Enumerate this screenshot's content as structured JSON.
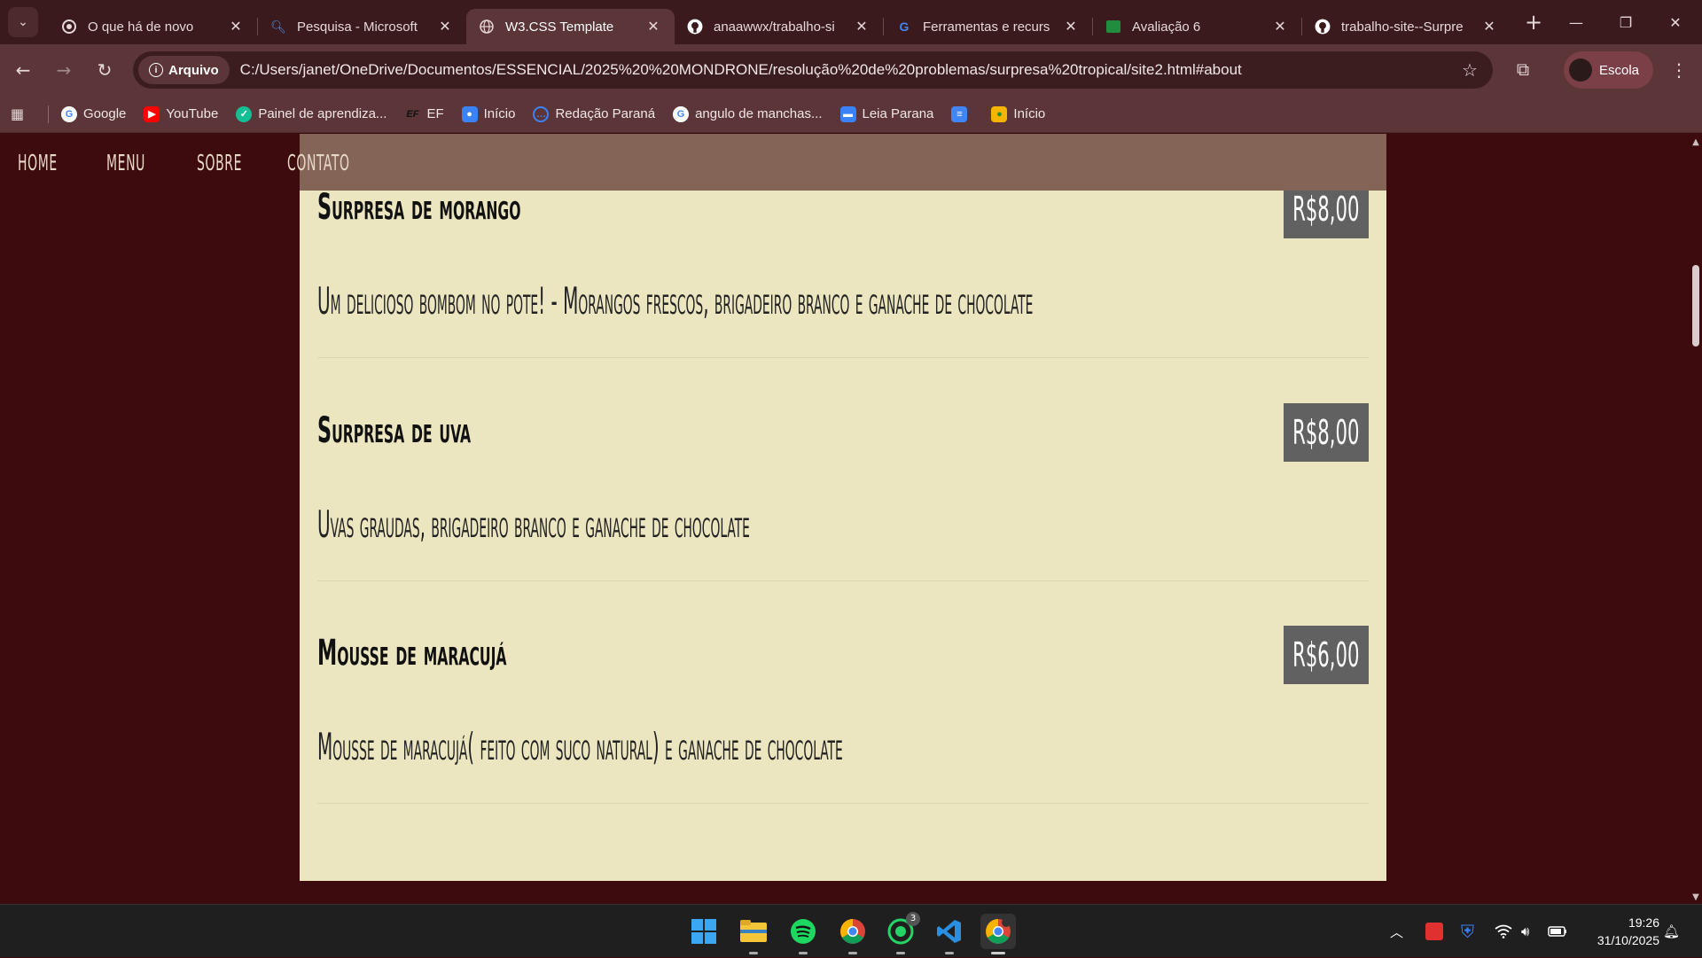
{
  "browser": {
    "tabs": [
      {
        "title": "O que há de novo",
        "icon": "chrome-icon",
        "active": false
      },
      {
        "title": "Pesquisa - Microsoft",
        "icon": "search-icon",
        "active": false
      },
      {
        "title": "W3.CSS Template",
        "icon": "globe-icon",
        "active": true
      },
      {
        "title": "anaawwx/trabalho-si",
        "icon": "github-icon",
        "active": false
      },
      {
        "title": "Ferramentas e recurs",
        "icon": "google-icon",
        "active": false
      },
      {
        "title": "Avaliação 6",
        "icon": "classroom-icon",
        "active": false
      },
      {
        "title": "trabalho-site--Surpre",
        "icon": "github-icon",
        "active": false
      }
    ],
    "security_chip": "Arquivo",
    "url": "C:/Users/janet/OneDrive/Documentos/ESSENCIAL/2025%20%20MONDRONE/resolução%20de%20problemas/surpresa%20tropical/site2.html#about",
    "profile_name": "Escola",
    "bookmarks": [
      {
        "label": "Google",
        "icon": "google-icon",
        "color": "#ffffff"
      },
      {
        "label": "YouTube",
        "icon": "youtube-icon",
        "color": "#ff0000"
      },
      {
        "label": "Painel de aprendiza...",
        "icon": "khan-icon",
        "color": "#14bf96"
      },
      {
        "label": "EF",
        "icon": "ef-icon",
        "color": "#222222"
      },
      {
        "label": "Início",
        "icon": "person-icon",
        "color": "#3b82f6"
      },
      {
        "label": "Redação Paraná",
        "icon": "chat-icon",
        "color": "#3b82f6"
      },
      {
        "label": "angulo de manchas...",
        "icon": "google-icon",
        "color": "#ffffff"
      },
      {
        "label": "Leia Parana",
        "icon": "book-icon",
        "color": "#3b82f6"
      },
      {
        "label": "",
        "icon": "docs-icon",
        "color": "#4285f4"
      },
      {
        "label": "Início",
        "icon": "classroom-icon",
        "color": "#f4b400"
      }
    ]
  },
  "site": {
    "nav": [
      "HOME",
      "MENU",
      "SOBRE",
      "CONTATO"
    ],
    "items": [
      {
        "name": "Surpresa de morango",
        "price": "R$8,00",
        "desc": "Um delicioso bombom no pote! - Morangos frescos, brigadeiro branco e ganache de chocolate"
      },
      {
        "name": "Surpresa de uva",
        "price": "R$8,00",
        "desc": "Uvas graudas, brigadeiro branco e ganache de chocolate"
      },
      {
        "name": "Mousse de maracujá",
        "price": "R$6,00",
        "desc": "Mousse de maracujá( feito com suco natural) e ganache de chocolate"
      }
    ]
  },
  "taskbar": {
    "apps": [
      "windows-start-icon",
      "file-explorer-icon",
      "spotify-icon",
      "chrome-icon",
      "whatsapp-icon",
      "vscode-icon",
      "chrome-profile-icon"
    ],
    "whatsapp_badge": "3",
    "time": "19:26",
    "date": "31/10/2025"
  },
  "colors": {
    "page_bg": "#3d0a0d",
    "card_bg": "#ebe5c0",
    "price_bg": "#616161",
    "nav_bg": "#846456",
    "chrome_frame": "#3a1a1c",
    "chrome_toolbar": "#5b3537"
  }
}
